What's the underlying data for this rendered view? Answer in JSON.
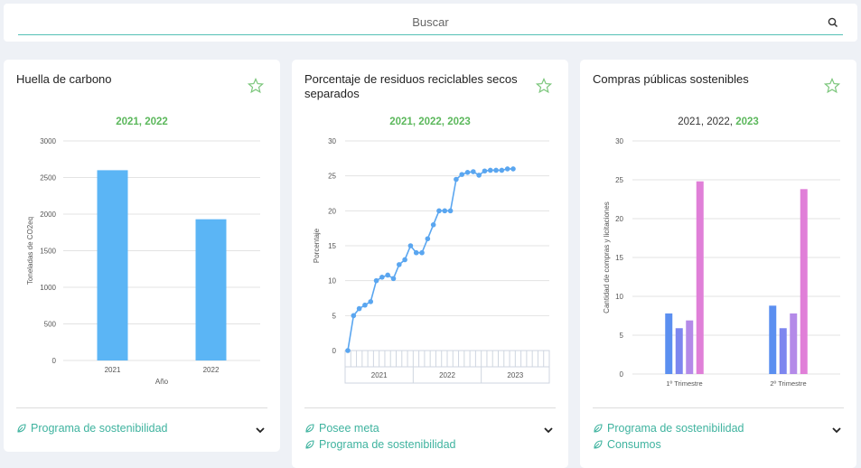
{
  "search": {
    "placeholder": "Buscar"
  },
  "cards": [
    {
      "title": "Huella de carbono",
      "years": [
        "2021",
        "2022"
      ],
      "footer": [
        "Programa de sostenibilidad"
      ],
      "colors": {
        "bar": "#5bb5f5"
      }
    },
    {
      "title": "Porcentaje de residuos reciclables secos separados",
      "years": [
        "2021",
        "2022",
        "2023"
      ],
      "footer": [
        "Posee meta",
        "Programa de sostenibilidad"
      ],
      "colors": {
        "line": "#5aa6f0"
      }
    },
    {
      "title": "Compras públicas sostenibles",
      "years": [
        "2021",
        "2022",
        "2023"
      ],
      "footer": [
        "Programa de sostenibilidad",
        "Consumos"
      ],
      "colors": {
        "series": [
          "#5b8ff0",
          "#7d86ef",
          "#b48ae8",
          "#e07fd8"
        ]
      }
    }
  ],
  "chart_data": [
    {
      "type": "bar",
      "categories": [
        "2021",
        "2022"
      ],
      "values": [
        2600,
        1930
      ],
      "xlabel": "Año",
      "ylabel": "Toneladas de CO2eq",
      "ylim": [
        0,
        3000
      ],
      "yticks": [
        "0",
        "500",
        "1000",
        "1500",
        "2000",
        "2500",
        "3000"
      ],
      "grid": true
    },
    {
      "type": "line",
      "y": [
        0,
        5,
        6,
        6.5,
        7,
        10,
        10.5,
        10.8,
        10.3,
        12.3,
        13,
        15,
        14,
        14,
        16,
        18,
        20,
        20,
        20,
        24.5,
        25.2,
        25.5,
        25.6,
        25.1,
        25.7,
        25.8,
        25.8,
        25.8,
        26,
        26
      ],
      "x_groups": [
        "2021",
        "2022",
        "2023"
      ],
      "ylabel": "Porcentaje",
      "ylim": [
        0,
        30
      ],
      "yticks": [
        "0",
        "5",
        "10",
        "15",
        "20",
        "25",
        "30"
      ],
      "grid": true
    },
    {
      "type": "bar",
      "categories": [
        "1º Trimestre",
        "2º Trimestre"
      ],
      "series": [
        {
          "values": [
            7.8,
            8.8
          ]
        },
        {
          "values": [
            5.9,
            5.9
          ]
        },
        {
          "values": [
            6.9,
            7.8
          ]
        },
        {
          "values": [
            24.8,
            23.8
          ]
        }
      ],
      "ylabel": "Cantidad de compras y licitaciones",
      "ylim": [
        0,
        30
      ],
      "yticks": [
        "0",
        "5",
        "10",
        "15",
        "20",
        "25",
        "30"
      ],
      "grid": true
    }
  ]
}
